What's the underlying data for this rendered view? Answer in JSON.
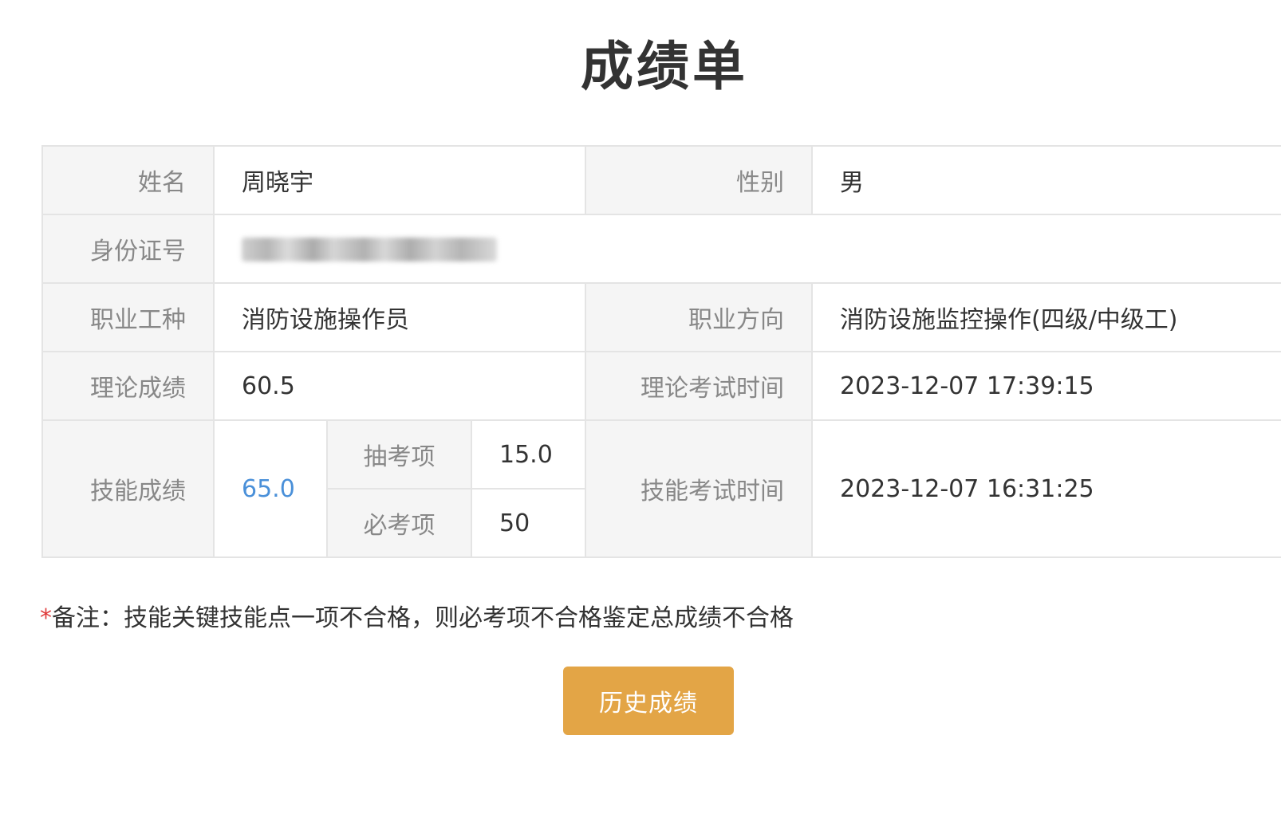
{
  "page": {
    "title": "成绩单"
  },
  "profile": {
    "name_label": "姓名",
    "name_value": "周晓宇",
    "gender_label": "性别",
    "gender_value": "男",
    "id_label": "身份证号",
    "occupation_label": "职业工种",
    "occupation_value": "消防设施操作员",
    "direction_label": "职业方向",
    "direction_value": "消防设施监控操作(四级/中级工)"
  },
  "theory": {
    "score_label": "理论成绩",
    "score_value": "60.5",
    "time_label": "理论考试时间",
    "time_value": "2023-12-07 17:39:15"
  },
  "skill": {
    "score_label": "技能成绩",
    "score_value": "65.0",
    "random_label": "抽考项",
    "random_value": "15.0",
    "required_label": "必考项",
    "required_value": "50",
    "time_label": "技能考试时间",
    "time_value": "2023-12-07 16:31:25"
  },
  "remark": {
    "star": "*",
    "text": "备注：技能关键技能点一项不合格，则必考项不合格鉴定总成绩不合格"
  },
  "actions": {
    "history_label": "历史成绩"
  },
  "colors": {
    "accent_button": "#e3a546",
    "link_value": "#4a90d9",
    "label_bg": "#f5f5f5",
    "remark_star": "#e03b3b"
  }
}
